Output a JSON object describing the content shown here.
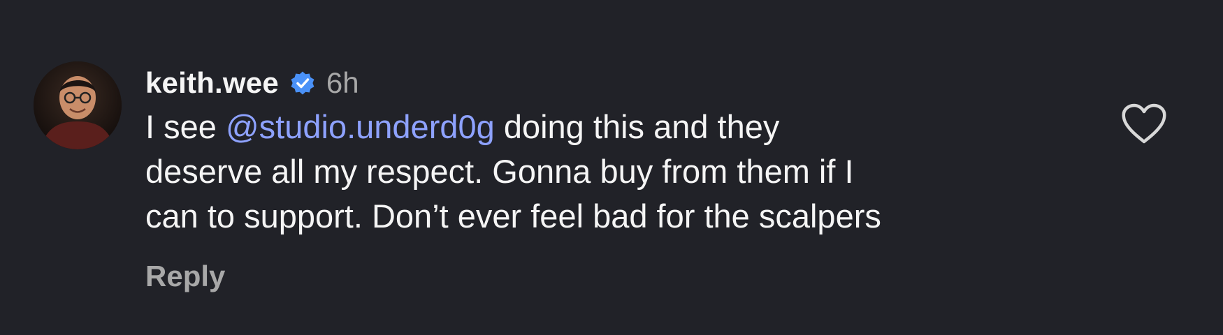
{
  "comment": {
    "username": "keith.wee",
    "verified_icon": "verified-badge-icon",
    "time": "6h",
    "text_prefix": "I see ",
    "mention": "@studio.underd0g",
    "text_line1_suffix": " doing this and they",
    "text_line2": "deserve all my respect. Gonna buy from them if I",
    "text_line3": "can to support. Don’t ever feel bad for the scalpers",
    "reply_label": "Reply",
    "like_icon": "heart-outline-icon"
  },
  "colors": {
    "background": "#212228",
    "text": "#f5f5f5",
    "secondary": "#a8a8a8",
    "mention": "#8ea2ff",
    "verified": "#4a91f7"
  }
}
